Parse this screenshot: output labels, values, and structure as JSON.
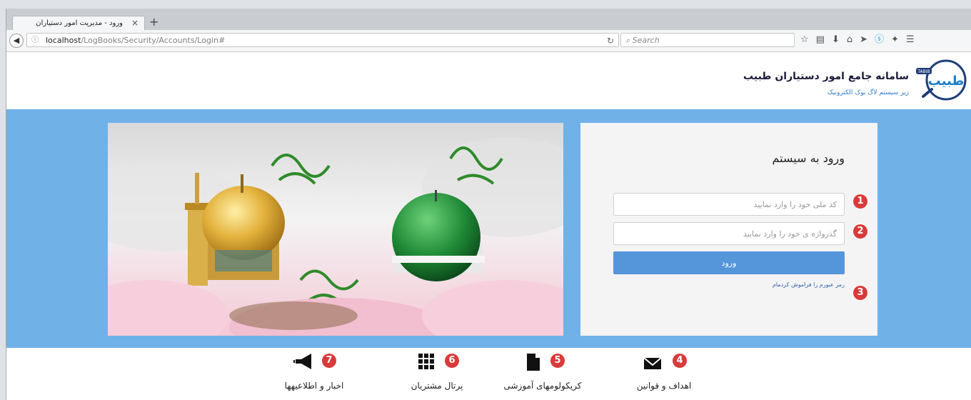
{
  "browser": {
    "tab_title": "ورود - مدیریت امور دستیاران",
    "close_glyph": "×",
    "new_tab_glyph": "+",
    "url_host": "localhost",
    "url_path": "/LogBooks/Security/Accounts/Login#",
    "search_placeholder": "Search"
  },
  "header": {
    "title": "سامانه جامع امور دستیاران طبیب",
    "subtitle": "زیر سیستم لاگ بوک الکترونیک",
    "logo_small_text": "TABIB",
    "logo_text": "طبیب"
  },
  "login": {
    "title": "ورود به سیستم",
    "national_code_placeholder": "کد ملی خود را وارد نمایید",
    "password_placeholder": "گذرواژه ی خود را وارد نمایید",
    "submit_label": "ورود",
    "forgot_label": "رمز عبورم را فراموش کردمام"
  },
  "badges": [
    "1",
    "2",
    "3",
    "4",
    "5",
    "6",
    "7"
  ],
  "footer": {
    "items": [
      {
        "label": "اهداف و قوانین",
        "icon": "envelope-icon"
      },
      {
        "label": "کریکولومهای آموزشی",
        "icon": "document-icon"
      },
      {
        "label": "پرتال مشتریان",
        "icon": "grid-icon"
      },
      {
        "label": "اخبار و اطلاعیهها",
        "icon": "megaphone-icon"
      }
    ]
  },
  "colors": {
    "band": "#70b1e8",
    "button": "#5595d9",
    "badge": "#d93a3a"
  }
}
